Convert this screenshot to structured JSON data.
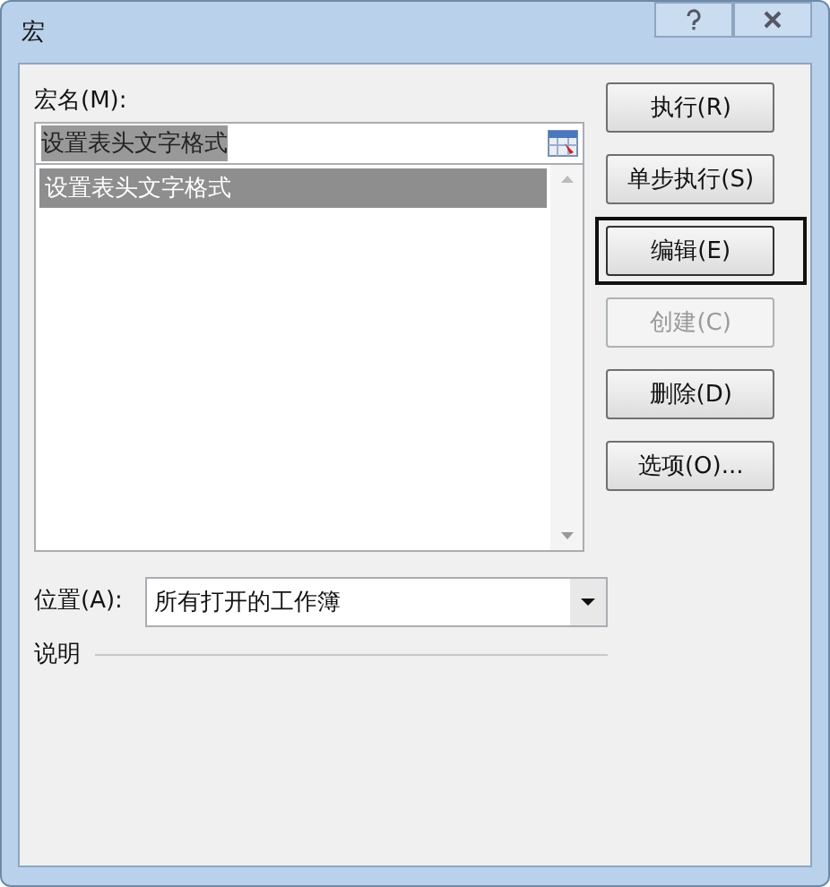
{
  "window": {
    "title": "宏"
  },
  "macro_name": {
    "label": "宏名(M):",
    "value": "设置表头文字格式"
  },
  "macro_list": {
    "items": [
      {
        "label": "设置表头文字格式",
        "selected": true
      }
    ]
  },
  "buttons": [
    {
      "label": "执行(R)",
      "disabled": false,
      "focused": false
    },
    {
      "label": "单步执行(S)",
      "disabled": false,
      "focused": false
    },
    {
      "label": "编辑(E)",
      "disabled": false,
      "focused": true
    },
    {
      "label": "创建(C)",
      "disabled": true,
      "focused": false
    },
    {
      "label": "删除(D)",
      "disabled": false,
      "focused": false
    },
    {
      "label": "选项(O)...",
      "disabled": false,
      "focused": false
    }
  ],
  "location": {
    "label": "位置(A):",
    "value": "所有打开的工作簿"
  },
  "description": {
    "label": "说明"
  }
}
